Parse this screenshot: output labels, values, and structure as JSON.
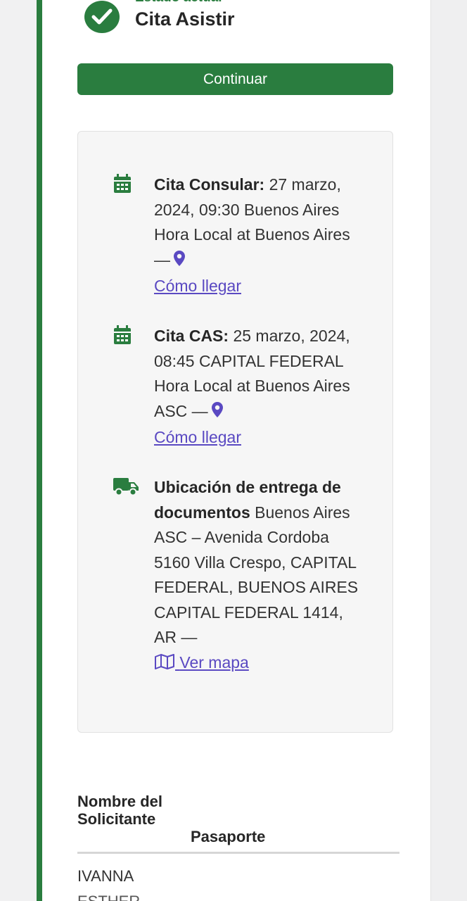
{
  "status": {
    "label": "Estado actual",
    "value": "Cita Asistir"
  },
  "actions": {
    "continue_label": "Continuar"
  },
  "appointments": {
    "consular": {
      "title": "Cita Consular:",
      "details": "27 marzo, 2024, 09:30 Buenos Aires Hora Local at Buenos Aires —",
      "link": "Cómo llegar"
    },
    "cas": {
      "title": "Cita CAS:",
      "details": "25 marzo, 2024, 08:45 CAPITAL FEDERAL Hora Local at Buenos Aires ASC —",
      "link": "Cómo llegar"
    },
    "delivery": {
      "title": "Ubicación de entrega de documentos",
      "details": "Buenos Aires ASC – Avenida Cordoba 5160 Villa Crespo, CAPITAL FEDERAL, BUENOS AIRES CAPITAL FEDERAL 1414, AR —",
      "link": "Ver mapa"
    }
  },
  "table": {
    "headers": [
      "Nombre del Solicitante",
      "Pasaporte"
    ],
    "rows": [
      {
        "name": "IVANNA"
      },
      {
        "name": "ESTHER"
      }
    ]
  },
  "colors": {
    "brand_green": "#2a7d3f",
    "link_purple": "#5a49c2"
  },
  "icons": [
    "check-circle-icon",
    "calendar-icon",
    "map-pin-icon",
    "truck-icon",
    "map-icon"
  ]
}
